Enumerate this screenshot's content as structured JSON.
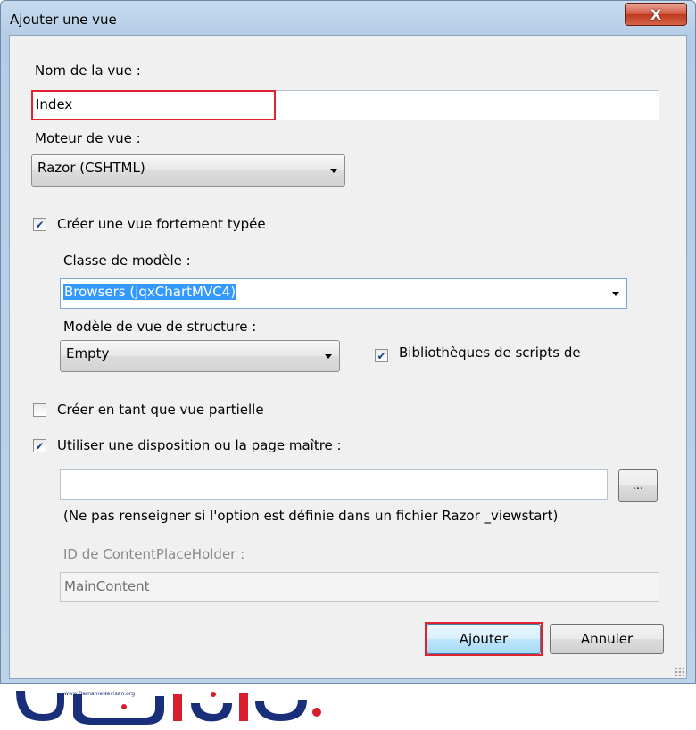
{
  "dialog": {
    "title": "Ajouter une vue",
    "close_label": "X",
    "view_name_label": "Nom de la vue :",
    "view_name_value": "Index",
    "engine_label": "Moteur de vue :",
    "engine_value": "Razor (CSHTML)",
    "strongly_typed_label": "Créer une vue fortement typée",
    "strongly_typed_checked": true,
    "model_class_label": "Classe de modèle :",
    "model_class_value": "Browsers (jqxChartMVC4)",
    "scaffold_label": "Modèle de vue de structure :",
    "scaffold_value": "Empty",
    "script_libs_label": "Bibliothèques de scripts de",
    "script_libs_checked": true,
    "partial_label": "Créer en tant que vue partielle",
    "partial_checked": false,
    "layout_label": "Utiliser une disposition ou la page maître :",
    "layout_checked": true,
    "layout_path_value": "",
    "browse_label": "...",
    "layout_hint": "(Ne pas renseigner si l'option est définie dans un fichier Razor _viewstart)",
    "placeholder_id_label": "ID de ContentPlaceHolder :",
    "placeholder_id_value": "MainContent",
    "add_button": "Ajouter",
    "cancel_button": "Annuler"
  },
  "watermark": {
    "url": "www.BarnameNevisan.org"
  },
  "colors": {
    "highlight": "#e0232e",
    "selection": "#3399ff",
    "logo_blue": "#1a2f7a",
    "logo_red": "#d81e2c"
  }
}
